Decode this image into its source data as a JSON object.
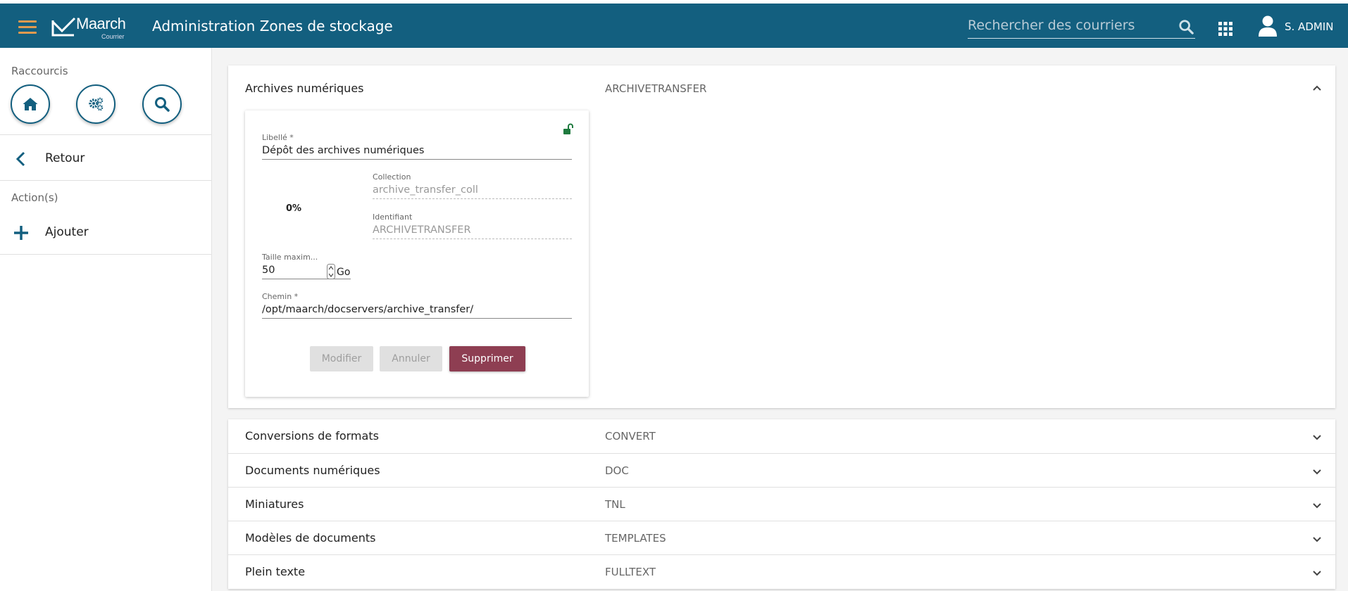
{
  "header": {
    "logo_text": "Maarch",
    "logo_sub": "Courrier",
    "title": "Administration Zones de stockage",
    "search_placeholder": "Rechercher des courriers",
    "user_name": "S. ADMIN"
  },
  "sidebar": {
    "shortcuts_label": "Raccourcis",
    "shortcuts": [
      {
        "icon": "home-icon"
      },
      {
        "icon": "gears-icon"
      },
      {
        "icon": "search-icon"
      }
    ],
    "back_label": "Retour",
    "actions_label": "Action(s)",
    "add_label": "Ajouter"
  },
  "docservers": {
    "expanded": {
      "name": "Archives numériques",
      "code": "ARCHIVETRANSFER",
      "form": {
        "label_title": "Libellé *",
        "label_value": "Dépôt des archives numériques",
        "collection_title": "Collection",
        "collection_value": "archive_transfer_coll",
        "identifier_title": "Identifiant",
        "identifier_value": "ARCHIVETRANSFER",
        "usage": "0%",
        "size_title": "Taille maxim...",
        "size_value": "50",
        "size_unit": "Go",
        "path_title": "Chemin *",
        "path_value": "/opt/maarch/docservers/archive_transfer/",
        "buttons": {
          "modify": "Modifier",
          "cancel": "Annuler",
          "delete": "Supprimer"
        }
      }
    },
    "collapsed": [
      {
        "name": "Conversions de formats",
        "code": "CONVERT"
      },
      {
        "name": "Documents numériques",
        "code": "DOC"
      },
      {
        "name": "Miniatures",
        "code": "TNL"
      },
      {
        "name": "Modèles de documents",
        "code": "TEMPLATES"
      },
      {
        "name": "Plein texte",
        "code": "FULLTEXT"
      }
    ]
  },
  "colors": {
    "header": "#135f7f",
    "menu_accent": "#e09a4f",
    "delete_button": "#8e3e52",
    "lock_open": "#1e7a3e"
  }
}
